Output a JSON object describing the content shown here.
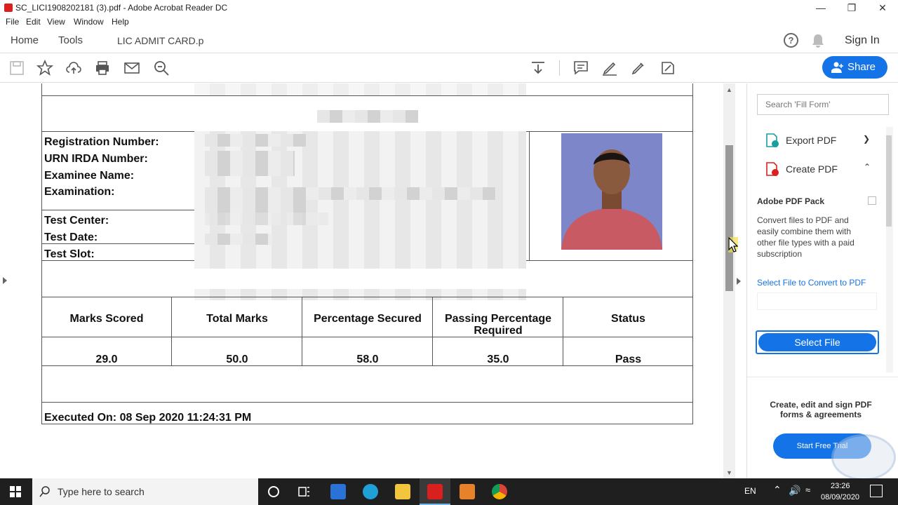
{
  "window": {
    "title": "SC_LICI1908202181 (3).pdf - Adobe Acrobat Reader DC"
  },
  "menu": [
    "File",
    "Edit",
    "View",
    "Window",
    "Help"
  ],
  "tabs": {
    "home": "Home",
    "tools": "Tools",
    "doc": "LIC ADMIT CARD.p"
  },
  "header": {
    "signin": "Sign In",
    "share": "Share"
  },
  "document": {
    "labels": [
      "Registration Number:",
      "URN IRDA Number:",
      "Examinee Name:",
      "Examination:",
      "Test Center:",
      "Test Date:",
      "Test Slot:"
    ],
    "results": {
      "headers": [
        "Marks Scored",
        "Total Marks",
        "Percentage Secured",
        "Passing Percentage Required",
        "Status"
      ],
      "values": [
        "29.0",
        "50.0",
        "58.0",
        "35.0",
        "Pass"
      ]
    },
    "executed": "Executed On: 08 Sep 2020 11:24:31 PM"
  },
  "pane": {
    "search_placeholder": "Search 'Fill Form'",
    "export": "Export PDF",
    "create": "Create PDF",
    "pack_title": "Adobe PDF Pack",
    "pack_desc": "Convert files to PDF and easily combine them with other file types with a paid subscription",
    "select_link": "Select File to Convert to PDF",
    "select_btn": "Select File",
    "promo": "Create, edit and sign PDF forms & agreements",
    "trial": "Start Free Trial"
  },
  "taskbar": {
    "search": "Type here to search",
    "lang": "EN",
    "time": "23:26",
    "date": "08/09/2020"
  },
  "colors": {
    "accent": "#1473e6",
    "adobe_red": "#d9201f"
  }
}
